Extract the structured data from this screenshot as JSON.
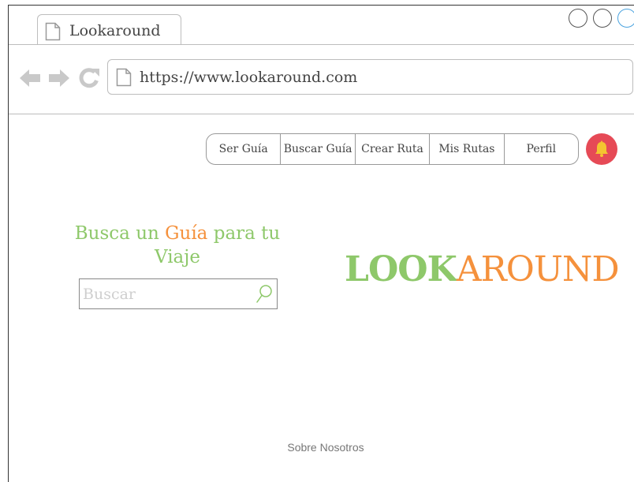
{
  "browser": {
    "tab_title": "Lookaround",
    "url": "https://www.lookaround.com"
  },
  "nav": {
    "items": [
      {
        "label": "Ser Guía"
      },
      {
        "label": "Buscar Guía"
      },
      {
        "label": "Crear Ruta"
      },
      {
        "label": "Mis Rutas"
      },
      {
        "label": "Perfil"
      }
    ]
  },
  "hero": {
    "headline_before": "Busca un ",
    "headline_accent": "Guía",
    "headline_after": " para tu Viaje",
    "search_placeholder": "Buscar"
  },
  "logo": {
    "part1": "LOOK",
    "part2": "AROUND"
  },
  "footer": {
    "link": "Sobre Nosotros"
  },
  "colors": {
    "green": "#8ec86a",
    "orange": "#f5913c",
    "bell_bg": "#e64a56",
    "window_control_active": "#4aa3df"
  },
  "icons": [
    "doc-icon",
    "back-arrow-icon",
    "forward-arrow-icon",
    "reload-icon",
    "bell-icon",
    "search-icon"
  ]
}
